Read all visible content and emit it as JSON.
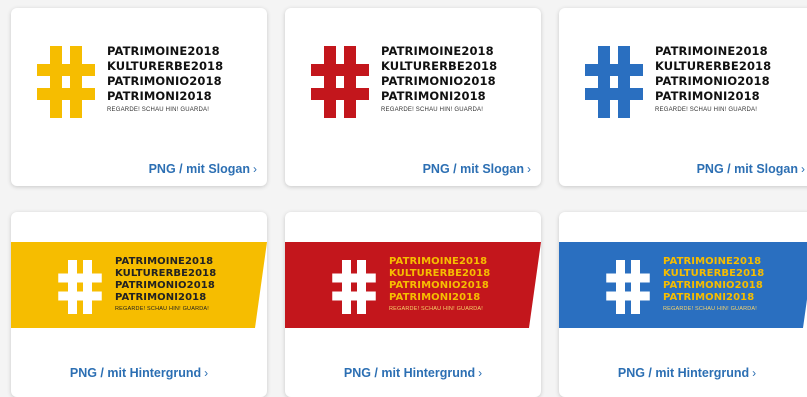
{
  "logo": {
    "lines": [
      "PATRIMOINE2018",
      "KULTURERBE2018",
      "PATRIMONIO2018",
      "PATRIMONI2018"
    ],
    "slogan": "REGARDE! SCHAU HIN! GUARDA!"
  },
  "colors": {
    "yellow": "#f6bd00",
    "red": "#c3161c",
    "blue": "#2a6fc0",
    "link": "#2c6fb3"
  },
  "cards": [
    {
      "variant": "slogan",
      "color": "yellow",
      "link_label": "PNG / mit Slogan",
      "chevron": "›"
    },
    {
      "variant": "slogan",
      "color": "red",
      "link_label": "PNG / mit Slogan",
      "chevron": "›"
    },
    {
      "variant": "slogan",
      "color": "blue",
      "link_label": "PNG / mit Slogan",
      "chevron": "›"
    },
    {
      "variant": "background",
      "color": "yellow",
      "link_label": "PNG / mit Hintergrund",
      "chevron": "›"
    },
    {
      "variant": "background",
      "color": "red",
      "link_label": "PNG / mit Hintergrund",
      "chevron": "›"
    },
    {
      "variant": "background",
      "color": "blue",
      "link_label": "PNG / mit Hintergrund",
      "chevron": "›"
    }
  ]
}
